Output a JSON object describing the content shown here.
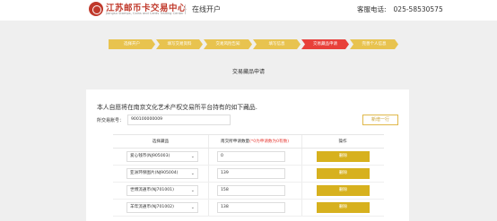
{
  "header": {
    "logo_title": "江苏邮币卡交易中心",
    "logo_subtitle": "Jiangsu Stamps, Coins and Cards Trading Center",
    "subtitle": "在线开户",
    "hotline_label": "客服电话:",
    "hotline_number": "025-58530575",
    "brand_color": "#c0392b"
  },
  "steps": [
    {
      "label": "选择开户",
      "state": "done"
    },
    {
      "label": "填写交易资料",
      "state": "done"
    },
    {
      "label": "交易风险告知",
      "state": "done"
    },
    {
      "label": "填写信息",
      "state": "done"
    },
    {
      "label": "交易藏品申请",
      "state": "active"
    },
    {
      "label": "完善个人信息",
      "state": "todo"
    }
  ],
  "page_title": "交易藏品申请",
  "form": {
    "intro": "本人自愿将在南京文化艺术产权交易所平台持有的如下藏品.",
    "account_label": "所交易账号：",
    "account_value": "900100000009",
    "add_row_label": "新增一行"
  },
  "table": {
    "headers": {
      "item": "选择藏品",
      "qty": "南交所申请数量",
      "qty_hint": "(*0为申请数为0有数)",
      "ops": "操作"
    },
    "rows": [
      {
        "item": "爱心钱币(NJ905003)",
        "qty": "0",
        "action": "删除"
      },
      {
        "item": "亚洲环保图片(NJ905004)",
        "qty": "139",
        "action": "删除"
      },
      {
        "item": "世博流通币(NJ701001)",
        "qty": "158",
        "action": "删除"
      },
      {
        "item": "羊年流通币(NJ701002)",
        "qty": "138",
        "action": "删除"
      }
    ]
  },
  "colors": {
    "accent": "#d7b11e",
    "active_step": "#e8403a"
  }
}
